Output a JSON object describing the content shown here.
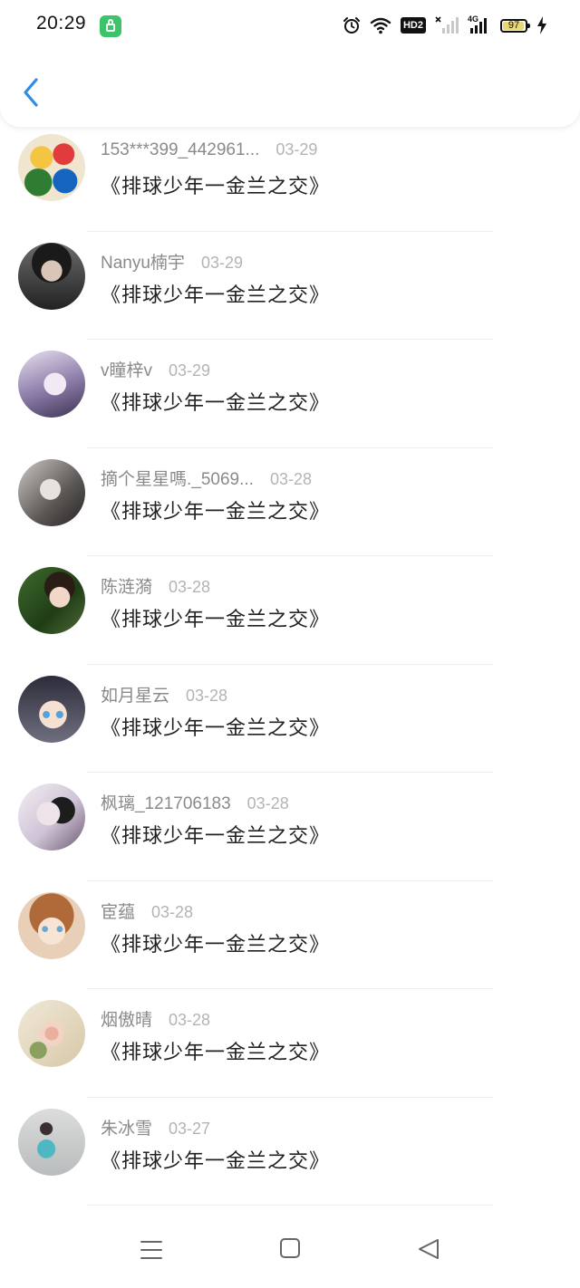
{
  "status_bar": {
    "time": "20:29",
    "hd_label": "HD2",
    "network_label": "4G",
    "battery_level": "97",
    "battery_fraction": 0.97,
    "battery_color": "#e8d873",
    "app_icon": "green-app-icon"
  },
  "header": {
    "back_icon": "chevron-left-icon",
    "accent_color": "#2f8be6"
  },
  "items": [
    {
      "username": "153***399_442961...",
      "date": "03-29",
      "title": "《排球少年一金兰之交》"
    },
    {
      "username": "Nanyu楠宇",
      "date": "03-29",
      "title": "《排球少年一金兰之交》"
    },
    {
      "username": "v瞳梓v",
      "date": "03-29",
      "title": "《排球少年一金兰之交》"
    },
    {
      "username": "摘个星星嗎._5069...",
      "date": "03-28",
      "title": "《排球少年一金兰之交》"
    },
    {
      "username": "陈涟漪",
      "date": "03-28",
      "title": "《排球少年一金兰之交》"
    },
    {
      "username": "如月星云",
      "date": "03-28",
      "title": "《排球少年一金兰之交》"
    },
    {
      "username": "枫璃_121706183",
      "date": "03-28",
      "title": "《排球少年一金兰之交》"
    },
    {
      "username": "宦蕴",
      "date": "03-28",
      "title": "《排球少年一金兰之交》"
    },
    {
      "username": "烟傲晴",
      "date": "03-28",
      "title": "《排球少年一金兰之交》"
    },
    {
      "username": "朱冰雪",
      "date": "03-27",
      "title": "《排球少年一金兰之交》"
    }
  ],
  "bottom_nav": {
    "menu_icon": "menu-icon",
    "home_icon": "home-square-icon",
    "back_icon": "back-triangle-icon"
  }
}
